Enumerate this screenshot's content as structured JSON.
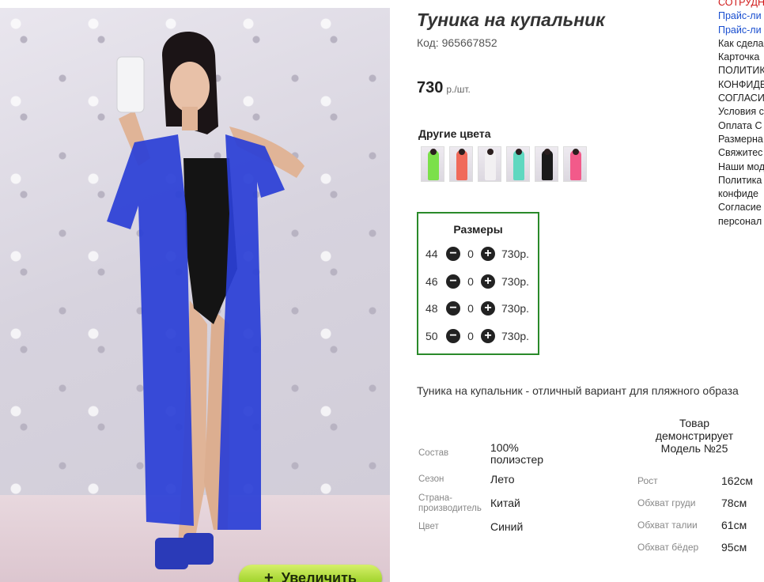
{
  "product": {
    "title": "Туника на купальник",
    "code": "Код: 965667852",
    "price": "730",
    "price_unit": "р./шт.",
    "description": "Туника на купальник - отличный вариант для пляжного образа",
    "zoom_label": "Увеличить",
    "zoom_icon": "+"
  },
  "colors": {
    "title": "Другие цвета",
    "swatches": [
      {
        "color": "#7be04a",
        "icon": "model-thumbnail"
      },
      {
        "color": "#f06a5a",
        "icon": "model-thumbnail"
      },
      {
        "color": "#f2f0f2",
        "icon": "model-thumbnail"
      },
      {
        "color": "#5fd8c0",
        "icon": "model-thumbnail"
      },
      {
        "color": "#1a1a1a",
        "icon": "model-thumbnail"
      },
      {
        "color": "#f25a8a",
        "icon": "model-thumbnail"
      }
    ]
  },
  "sizes": {
    "title": "Размеры",
    "minus_icon": "−",
    "plus_icon": "+",
    "rows": [
      {
        "size": "44",
        "qty": "0",
        "price": "730р."
      },
      {
        "size": "46",
        "qty": "0",
        "price": "730р."
      },
      {
        "size": "48",
        "qty": "0",
        "price": "730р."
      },
      {
        "size": "50",
        "qty": "0",
        "price": "730р."
      }
    ]
  },
  "specs": [
    {
      "key": "Состав",
      "value": "100% полиэстер"
    },
    {
      "key": "Сезон",
      "value": "Лето"
    },
    {
      "key": "Страна-производитель",
      "value": "Китай"
    },
    {
      "key": "Цвет",
      "value": "Синий"
    }
  ],
  "model": {
    "heading": "Товар демонстрирует Модель №25",
    "measures": [
      {
        "key": "Рост",
        "value": "162см"
      },
      {
        "key": "Обхват груди",
        "value": "78см"
      },
      {
        "key": "Обхват талии",
        "value": "61см"
      },
      {
        "key": "Обхват бёдер",
        "value": "95см"
      }
    ]
  },
  "side_links": [
    {
      "label": "СОТРУДН",
      "tone": "red"
    },
    {
      "label": "Прайс-ли",
      "tone": "blue"
    },
    {
      "label": "Прайс-ли",
      "tone": "blue"
    },
    {
      "label": "Как сдела",
      "tone": "dark"
    },
    {
      "label": "Карточка",
      "tone": "dark"
    },
    {
      "label": "ПОЛИТИК",
      "tone": "dark"
    },
    {
      "label": "КОНФИДЕ",
      "tone": "dark"
    },
    {
      "label": "СОГЛАСИ",
      "tone": "dark"
    },
    {
      "label": "Условия с",
      "tone": "dark"
    },
    {
      "label": "Оплата С",
      "tone": "dark"
    },
    {
      "label": "Размерна",
      "tone": "dark"
    },
    {
      "label": "Свяжитес",
      "tone": "dark"
    },
    {
      "label": "Наши мод",
      "tone": "dark"
    },
    {
      "label": "Политика",
      "tone": "dark"
    },
    {
      "label": "конфиде",
      "tone": "dark"
    },
    {
      "label": "Согласие",
      "tone": "dark"
    },
    {
      "label": "персонал",
      "tone": "dark"
    }
  ],
  "accent_colors": {
    "sizes_border": "#2a8a2a",
    "zoom_button": "#a9d836",
    "tunic": "#2b3fd6"
  }
}
